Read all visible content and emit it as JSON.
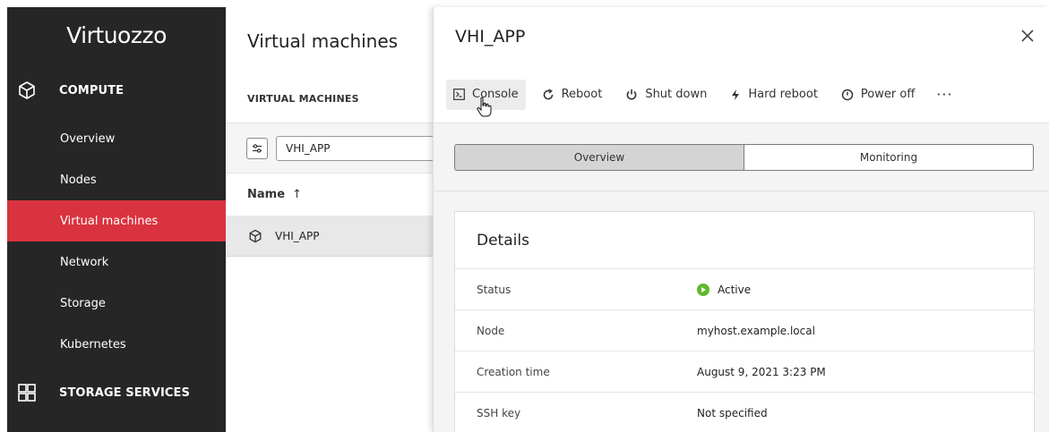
{
  "brand": {
    "logo_text": "Virtuozzo"
  },
  "sidebar": {
    "compute_section": {
      "label": "COMPUTE",
      "icon": "cube-icon"
    },
    "items": [
      {
        "label": "Overview"
      },
      {
        "label": "Nodes"
      },
      {
        "label": "Virtual machines",
        "active": true
      },
      {
        "label": "Network"
      },
      {
        "label": "Storage"
      },
      {
        "label": "Kubernetes"
      }
    ],
    "storage_section": {
      "label": "STORAGE SERVICES",
      "icon": "grid-icon"
    }
  },
  "list_panel": {
    "title": "Virtual machines",
    "subtitle": "VIRTUAL MACHINES",
    "search": {
      "value": "VHI_APP"
    },
    "column_header": "Name",
    "sort_icon": "arrow-up-icon",
    "rows": [
      {
        "name": "VHI_APP"
      }
    ]
  },
  "detail": {
    "title": "VHI_APP",
    "toolbar": {
      "console": "Console",
      "reboot": "Reboot",
      "shut_down": "Shut down",
      "hard_reboot": "Hard reboot",
      "power_off": "Power off",
      "more": "···"
    },
    "tabs": [
      {
        "label": "Overview",
        "active": true
      },
      {
        "label": "Monitoring"
      }
    ],
    "details_card": {
      "title": "Details",
      "rows": [
        {
          "key": "Status",
          "value": "Active"
        },
        {
          "key": "Node",
          "value": "myhost.example.local"
        },
        {
          "key": "Creation time",
          "value": "August 9, 2021 3:23 PM"
        },
        {
          "key": "SSH key",
          "value": "Not specified"
        }
      ]
    }
  },
  "colors": {
    "accent": "#d9333f",
    "sidebar_bg": "#262626",
    "status_active": "#5fb82f"
  }
}
